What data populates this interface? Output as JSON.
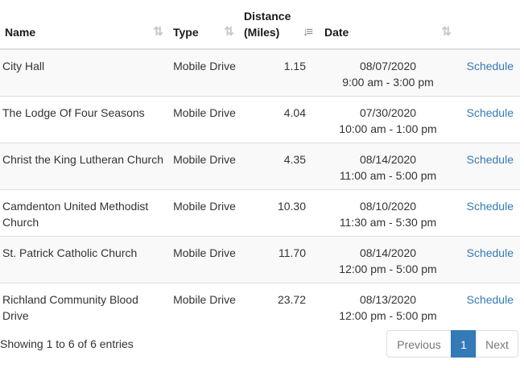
{
  "table": {
    "columns": [
      {
        "label": "Name"
      },
      {
        "label": "Type"
      },
      {
        "label": "Distance (Miles)",
        "label_line1": "Distance",
        "label_line2": "(Miles)"
      },
      {
        "label": "Date"
      }
    ],
    "sorted_column": "Distance (Miles)",
    "sort_direction": "ascending",
    "rows": [
      {
        "name": "City Hall",
        "type": "Mobile Drive",
        "distance": "1.15",
        "date": "08/07/2020",
        "time": "9:00 am - 3:00 pm",
        "action": "Schedule"
      },
      {
        "name": "The Lodge Of Four Seasons",
        "type": "Mobile Drive",
        "distance": "4.04",
        "date": "07/30/2020",
        "time": "10:00 am - 1:00 pm",
        "action": "Schedule"
      },
      {
        "name": "Christ the King Lutheran Church",
        "type": "Mobile Drive",
        "distance": "4.35",
        "date": "08/14/2020",
        "time": "11:00 am - 5:00 pm",
        "action": "Schedule"
      },
      {
        "name": "Camdenton United Methodist Church",
        "type": "Mobile Drive",
        "distance": "10.30",
        "date": "08/10/2020",
        "time": "11:30 am - 5:30 pm",
        "action": "Schedule"
      },
      {
        "name": "St. Patrick Catholic Church",
        "type": "Mobile Drive",
        "distance": "11.70",
        "date": "08/14/2020",
        "time": "12:00 pm - 5:00 pm",
        "action": "Schedule"
      },
      {
        "name": "Richland Community Blood Drive",
        "type": "Mobile Drive",
        "distance": "23.72",
        "date": "08/13/2020",
        "time": "12:00 pm - 5:00 pm",
        "action": "Schedule"
      }
    ]
  },
  "footer": {
    "info": "Showing 1 to 6 of 6 entries",
    "pagination": {
      "previous": "Previous",
      "current": "1",
      "next": "Next"
    }
  },
  "colors": {
    "link": "#337ab7",
    "active_page": "#337ab7",
    "stripe": "#f9f9f9",
    "border": "#dddddd"
  }
}
